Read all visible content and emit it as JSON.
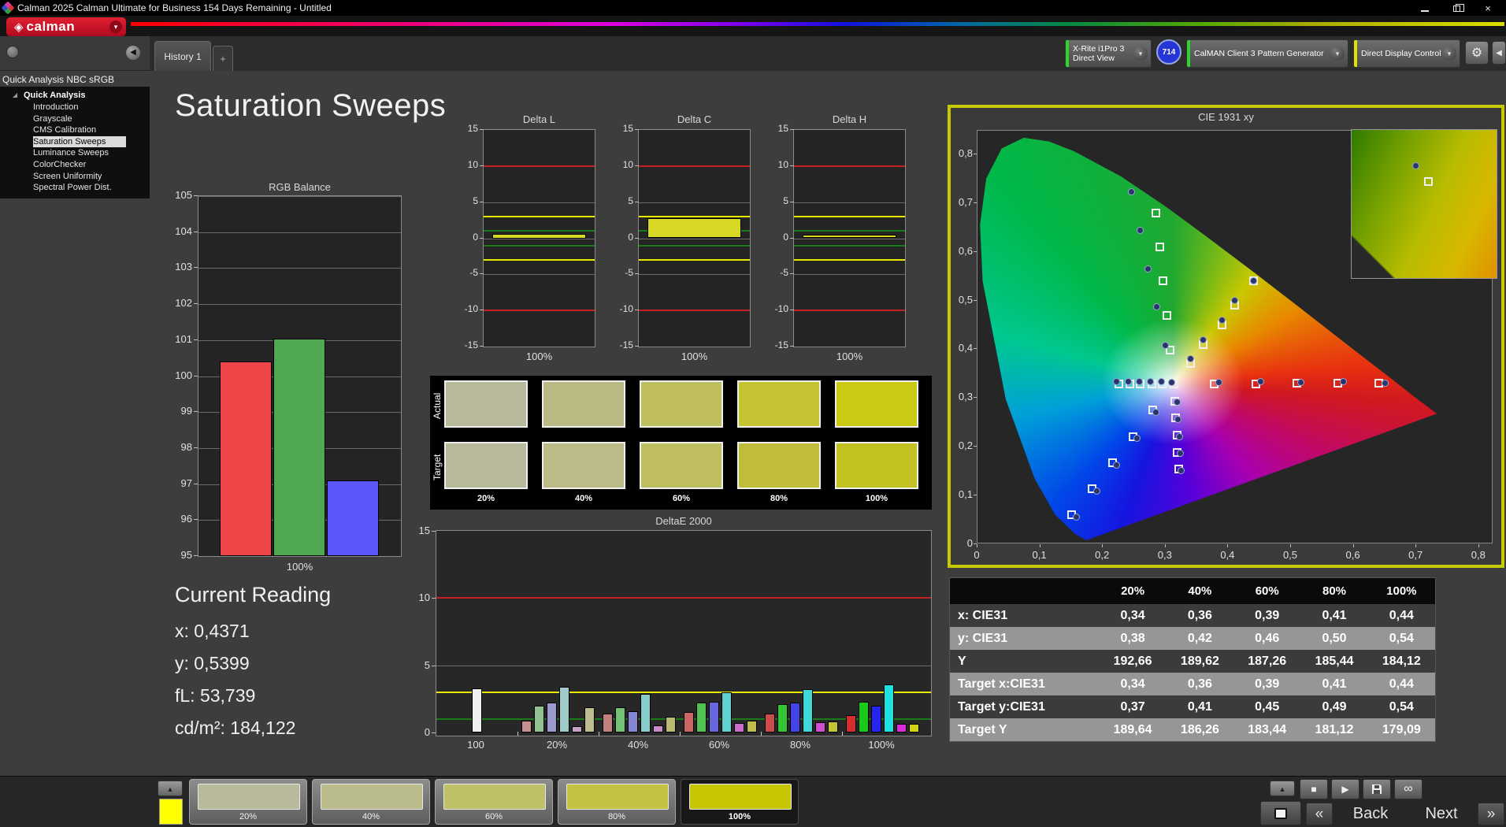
{
  "window": {
    "title": "Calman 2025 Calman Ultimate for Business 154 Days Remaining  - Untitled"
  },
  "icons": {
    "close": "×",
    "dropdown": "▾",
    "logo_diamond": "◈",
    "gear": "⚙",
    "collapse_left": "◀",
    "up_arrow": "▲",
    "stop": "■",
    "play": "▶",
    "loop": "∞",
    "tab_add": "+",
    "back_chevrons": "«",
    "next_chevrons": "»"
  },
  "logo": {
    "text": "calman"
  },
  "tab_bar": {
    "active_tab": "History 1"
  },
  "toolbar": {
    "meter_device": {
      "line1": "X-Rite i1Pro 3",
      "line2": "Direct View",
      "badge": "714",
      "accent": "#2fd42f"
    },
    "pattern_generator": {
      "label": "CalMAN Client 3 Pattern Generator",
      "accent": "#2fd42f"
    },
    "display_control": {
      "label": "Direct Display Control",
      "accent": "#e2e200"
    }
  },
  "sidebar": {
    "title": "Quick Analysis NBC sRGB",
    "root": "Quick Analysis",
    "selected_index": 3,
    "items": [
      "Introduction",
      "Grayscale",
      "CMS Calibration",
      "Saturation Sweeps",
      "Luminance Sweeps",
      "ColorChecker",
      "Screen Uniformity",
      "Spectral Power Dist."
    ]
  },
  "page_title": "Saturation Sweeps",
  "current_reading": {
    "heading": "Current Reading",
    "values": [
      "x: 0,4371",
      "y: 0,5399",
      "fL: 53,739",
      "cd/m²: 184,122"
    ]
  },
  "swatch_compare": {
    "row_labels": [
      "Actual",
      "Target"
    ],
    "columns": [
      "20%",
      "40%",
      "60%",
      "80%",
      "100%"
    ],
    "actual_colors": [
      "#b7b99a",
      "#babb84",
      "#bfbf60",
      "#c5c433",
      "#cbca12"
    ],
    "target_colors": [
      "#b8b99a",
      "#babb86",
      "#bfbe61",
      "#c0bd3a",
      "#c2c122"
    ]
  },
  "results_table": {
    "columns": [
      "20%",
      "40%",
      "60%",
      "80%",
      "100%"
    ],
    "rows": [
      {
        "label": "x: CIE31",
        "values": [
          "0,34",
          "0,36",
          "0,39",
          "0,41",
          "0,44"
        ]
      },
      {
        "label": "y: CIE31",
        "values": [
          "0,38",
          "0,42",
          "0,46",
          "0,50",
          "0,54"
        ]
      },
      {
        "label": "Y",
        "values": [
          "192,66",
          "189,62",
          "187,26",
          "185,44",
          "184,12"
        ]
      },
      {
        "label": "Target x:CIE31",
        "values": [
          "0,34",
          "0,36",
          "0,39",
          "0,41",
          "0,44"
        ]
      },
      {
        "label": "Target y:CIE31",
        "values": [
          "0,37",
          "0,41",
          "0,45",
          "0,49",
          "0,54"
        ]
      },
      {
        "label": "Target Y",
        "values": [
          "189,64",
          "186,26",
          "183,44",
          "181,12",
          "179,09"
        ]
      }
    ]
  },
  "bottom_bar": {
    "highlight_color": "#ffff00",
    "selected_index": 4,
    "patches": [
      {
        "label": "20%",
        "color": "#b9ba9c"
      },
      {
        "label": "40%",
        "color": "#babb8b"
      },
      {
        "label": "60%",
        "color": "#bfc068"
      },
      {
        "label": "80%",
        "color": "#c3c243"
      },
      {
        "label": "100%",
        "color": "#c6c503"
      }
    ],
    "back_label": "Back",
    "next_label": "Next"
  },
  "chart_data": [
    {
      "id": "rgb_balance",
      "type": "bar",
      "title": "RGB Balance",
      "categories": [
        "Red",
        "Green",
        "Blue"
      ],
      "values": [
        100.4,
        101.05,
        97.1
      ],
      "colors": [
        "#ee4548",
        "#4fa952",
        "#5b57fa"
      ],
      "ylim": [
        95,
        105
      ],
      "yticks": [
        105,
        104,
        103,
        102,
        101,
        100,
        99,
        98,
        97,
        96,
        95
      ],
      "xlabel": "100%",
      "ylabel": ""
    },
    {
      "id": "delta_l",
      "type": "bar",
      "title": "Delta L",
      "values": [
        0.6
      ],
      "bar_color": "#d6d824",
      "ylim": [
        -15,
        15
      ],
      "yticks": [
        15,
        10,
        5,
        0,
        -5,
        -10,
        -15
      ],
      "xlabel": "100%",
      "ref_lines": [
        {
          "value": 10,
          "color": "#c42222"
        },
        {
          "value": -10,
          "color": "#c42222"
        },
        {
          "value": 3,
          "color": "#e8e800"
        },
        {
          "value": -3,
          "color": "#e8e800"
        },
        {
          "value": 1,
          "color": "#1a7a1a"
        },
        {
          "value": -1,
          "color": "#1a7a1a"
        }
      ]
    },
    {
      "id": "delta_c",
      "type": "bar",
      "title": "Delta C",
      "values": [
        2.8
      ],
      "bar_color": "#d6d824",
      "ylim": [
        -15,
        15
      ],
      "yticks": [
        15,
        10,
        5,
        0,
        -5,
        -10,
        -15
      ],
      "xlabel": "100%",
      "ref_lines": [
        {
          "value": 10,
          "color": "#c42222"
        },
        {
          "value": -10,
          "color": "#c42222"
        },
        {
          "value": 3,
          "color": "#e8e800"
        },
        {
          "value": -3,
          "color": "#e8e800"
        },
        {
          "value": 1,
          "color": "#1a7a1a"
        },
        {
          "value": -1,
          "color": "#1a7a1a"
        }
      ]
    },
    {
      "id": "delta_h",
      "type": "bar",
      "title": "Delta H",
      "values": [
        0.5
      ],
      "bar_color": "#d6d824",
      "ylim": [
        -15,
        15
      ],
      "yticks": [
        15,
        10,
        5,
        0,
        -5,
        -10,
        -15
      ],
      "xlabel": "100%",
      "ref_lines": [
        {
          "value": 10,
          "color": "#c42222"
        },
        {
          "value": -10,
          "color": "#c42222"
        },
        {
          "value": 3,
          "color": "#e8e800"
        },
        {
          "value": -3,
          "color": "#e8e800"
        },
        {
          "value": 1,
          "color": "#1a7a1a"
        },
        {
          "value": -1,
          "color": "#1a7a1a"
        }
      ]
    },
    {
      "id": "deltae_2000",
      "type": "grouped-bar",
      "title": "DeltaE 2000",
      "ylim": [
        0,
        15
      ],
      "yticks": [
        15,
        10,
        5,
        0
      ],
      "ref_lines": [
        {
          "value": 10,
          "color": "#c42222"
        },
        {
          "value": 3,
          "color": "#e8e800"
        },
        {
          "value": 1,
          "color": "#1a7a1a"
        }
      ],
      "gridlines": [
        5
      ],
      "groups": [
        {
          "label": "100",
          "values": [
            3.3
          ],
          "colors": [
            "#efefef"
          ]
        },
        {
          "label": "20%",
          "values": [
            0.9,
            2.0,
            2.2,
            3.4,
            0.45,
            1.85
          ],
          "colors": [
            "#c49090",
            "#92c292",
            "#9a9ad0",
            "#a0caca",
            "#c8a2c8",
            "#bcbc8e"
          ]
        },
        {
          "label": "40%",
          "values": [
            1.4,
            1.9,
            1.6,
            2.85,
            0.5,
            1.15
          ],
          "colors": [
            "#c67f7f",
            "#74c074",
            "#8585d2",
            "#88cbcb",
            "#c98cc9",
            "#b9b972"
          ]
        },
        {
          "label": "60%",
          "values": [
            1.5,
            2.2,
            2.3,
            3.0,
            0.7,
            0.9
          ],
          "colors": [
            "#c96666",
            "#52c152",
            "#6868dc",
            "#60d0d0",
            "#cb6ccb",
            "#bdbd50"
          ]
        },
        {
          "label": "80%",
          "values": [
            1.4,
            2.1,
            2.2,
            3.2,
            0.75,
            0.8
          ],
          "colors": [
            "#cd4c4c",
            "#34c534",
            "#4444e6",
            "#40d8d8",
            "#d04ed0",
            "#c6c634"
          ]
        },
        {
          "label": "100%",
          "values": [
            1.3,
            2.3,
            2.0,
            3.6,
            0.65,
            0.65
          ],
          "colors": [
            "#d32f2f",
            "#19cb19",
            "#2525ef",
            "#20e0e0",
            "#dd2add",
            "#d2d215"
          ]
        }
      ]
    },
    {
      "id": "cie_1931",
      "type": "scatter",
      "title": "CIE 1931 xy",
      "xlim": [
        0,
        0.8
      ],
      "ylim": [
        0,
        0.85
      ],
      "xtick_values": [
        0,
        0.1,
        0.2,
        0.3,
        0.4,
        0.5,
        0.6,
        0.7,
        0.8
      ],
      "xtick_labels": [
        "0",
        "0,1",
        "0,2",
        "0,3",
        "0,4",
        "0,5",
        "0,6",
        "0,7",
        "0,8"
      ],
      "ytick_values": [
        0,
        0.1,
        0.2,
        0.3,
        0.4,
        0.5,
        0.6,
        0.7,
        0.8
      ],
      "ytick_labels": [
        "0",
        "0,1",
        "0,2",
        "0,3",
        "0,4",
        "0,5",
        "0,6",
        "0,7",
        "0,8"
      ],
      "white_point": [
        0.313,
        0.329
      ],
      "sweeps": [
        {
          "name": "red",
          "targets": [
            [
              0.378,
              0.329
            ],
            [
              0.444,
              0.329
            ],
            [
              0.509,
              0.33
            ],
            [
              0.575,
              0.33
            ],
            [
              0.64,
              0.33
            ]
          ],
          "measured": [
            [
              0.385,
              0.332
            ],
            [
              0.452,
              0.333
            ],
            [
              0.516,
              0.332
            ],
            [
              0.583,
              0.333
            ],
            [
              0.65,
              0.331
            ]
          ]
        },
        {
          "name": "green",
          "targets": [
            [
              0.307,
              0.399
            ],
            [
              0.302,
              0.469
            ],
            [
              0.296,
              0.54
            ],
            [
              0.291,
              0.61
            ],
            [
              0.285,
              0.68
            ]
          ],
          "measured": [
            [
              0.299,
              0.408
            ],
            [
              0.286,
              0.487
            ],
            [
              0.272,
              0.565
            ],
            [
              0.259,
              0.644
            ],
            [
              0.245,
              0.723
            ]
          ]
        },
        {
          "name": "blue",
          "targets": [
            [
              0.28,
              0.275
            ],
            [
              0.248,
              0.221
            ],
            [
              0.215,
              0.168
            ],
            [
              0.183,
              0.114
            ],
            [
              0.15,
              0.06
            ]
          ],
          "measured": [
            [
              0.285,
              0.271
            ],
            [
              0.254,
              0.217
            ],
            [
              0.222,
              0.163
            ],
            [
              0.19,
              0.109
            ],
            [
              0.158,
              0.056
            ]
          ]
        },
        {
          "name": "cyan",
          "targets": [
            [
              0.295,
              0.329
            ],
            [
              0.278,
              0.329
            ],
            [
              0.26,
              0.329
            ],
            [
              0.243,
              0.329
            ],
            [
              0.225,
              0.329
            ]
          ],
          "measured": [
            [
              0.293,
              0.333
            ],
            [
              0.276,
              0.333
            ],
            [
              0.258,
              0.333
            ],
            [
              0.24,
              0.333
            ],
            [
              0.222,
              0.333
            ]
          ]
        },
        {
          "name": "magenta",
          "targets": [
            [
              0.315,
              0.294
            ],
            [
              0.316,
              0.259
            ],
            [
              0.318,
              0.224
            ],
            [
              0.319,
              0.189
            ],
            [
              0.321,
              0.154
            ]
          ],
          "measured": [
            [
              0.318,
              0.291
            ],
            [
              0.32,
              0.256
            ],
            [
              0.322,
              0.221
            ],
            [
              0.323,
              0.186
            ],
            [
              0.325,
              0.151
            ]
          ]
        },
        {
          "name": "yellow",
          "targets": [
            [
              0.34,
              0.37
            ],
            [
              0.36,
              0.41
            ],
            [
              0.39,
              0.45
            ],
            [
              0.41,
              0.49
            ],
            [
              0.44,
              0.54
            ]
          ],
          "measured": [
            [
              0.34,
              0.38
            ],
            [
              0.36,
              0.42
            ],
            [
              0.39,
              0.46
            ],
            [
              0.41,
              0.5
            ],
            [
              0.44,
              0.54
            ]
          ]
        }
      ],
      "inset_points": [
        {
          "type": "measured",
          "x": 42,
          "y": 22
        },
        {
          "type": "target",
          "x": 50,
          "y": 32
        }
      ]
    }
  ]
}
